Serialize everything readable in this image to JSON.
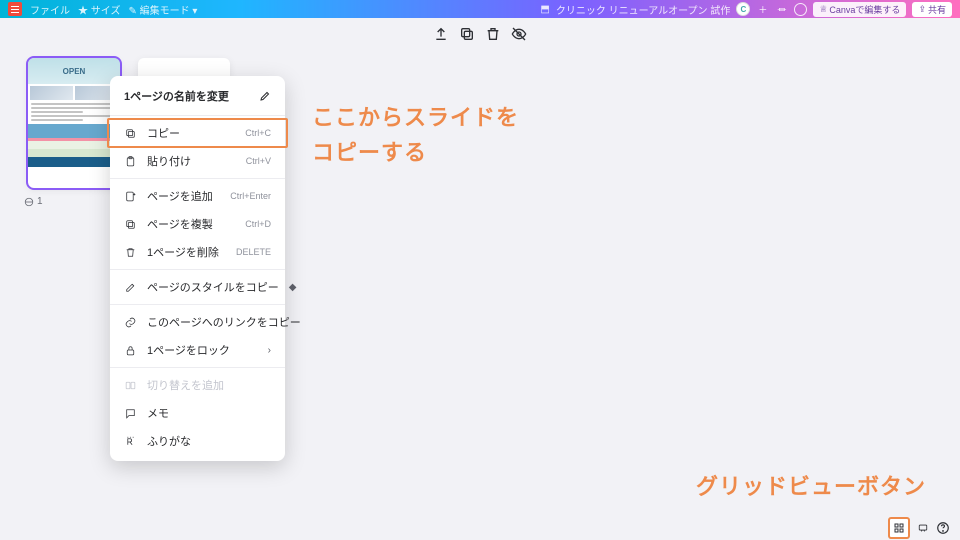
{
  "topbar": {
    "file": "ファイル",
    "resize": "サイズ",
    "edit_mode": "編集モード",
    "crown": "",
    "doc_title": "クリニック リニューアルオープン 試作",
    "canva_edit": "Canvaで編集する",
    "share": "共有"
  },
  "thumbnail": {
    "open": "OPEN",
    "label_prefix": "1"
  },
  "context_menu": {
    "title": "1ページの名前を変更",
    "copy": "コピー",
    "copy_sc": "Ctrl+C",
    "paste": "貼り付け",
    "paste_sc": "Ctrl+V",
    "add_page": "ページを追加",
    "add_page_sc": "Ctrl+Enter",
    "duplicate": "ページを複製",
    "duplicate_sc": "Ctrl+D",
    "delete": "1ページを削除",
    "delete_sc": "DELETE",
    "copy_style": "ページのスタイルをコピー",
    "copy_link": "このページへのリンクをコピー",
    "lock": "1ページをロック",
    "transition": "切り替えを追加",
    "note": "メモ",
    "ruby": "ふりがな"
  },
  "annotations": {
    "copy_here_1": "ここからスライドを",
    "copy_here_2": "コピーする",
    "grid_button": "グリッドビューボタン"
  }
}
